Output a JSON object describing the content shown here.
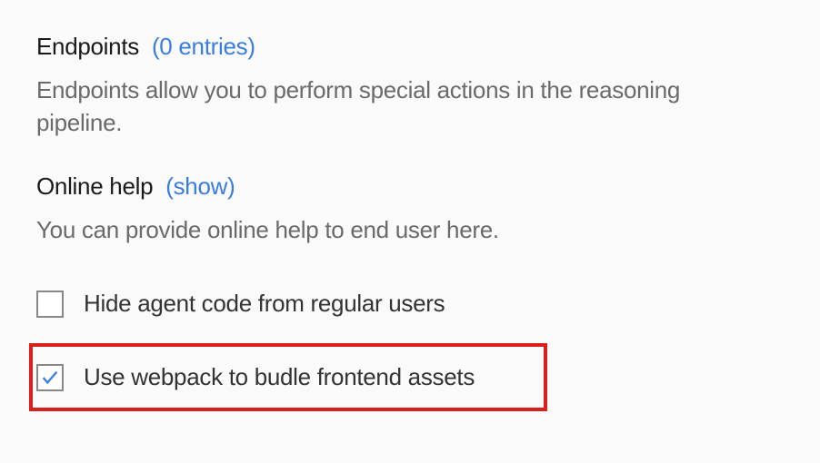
{
  "endpoints": {
    "title": "Endpoints",
    "count_label": "(0 entries)",
    "description": "Endpoints allow you to perform special actions in the reasoning pipeline."
  },
  "onlineHelp": {
    "title": "Online help",
    "show_label": "(show)",
    "description": "You can provide online help to end user here."
  },
  "options": {
    "hideCode": {
      "label": "Hide agent code from regular users",
      "checked": false
    },
    "webpack": {
      "label": "Use webpack to budle frontend assets",
      "checked": true
    }
  }
}
